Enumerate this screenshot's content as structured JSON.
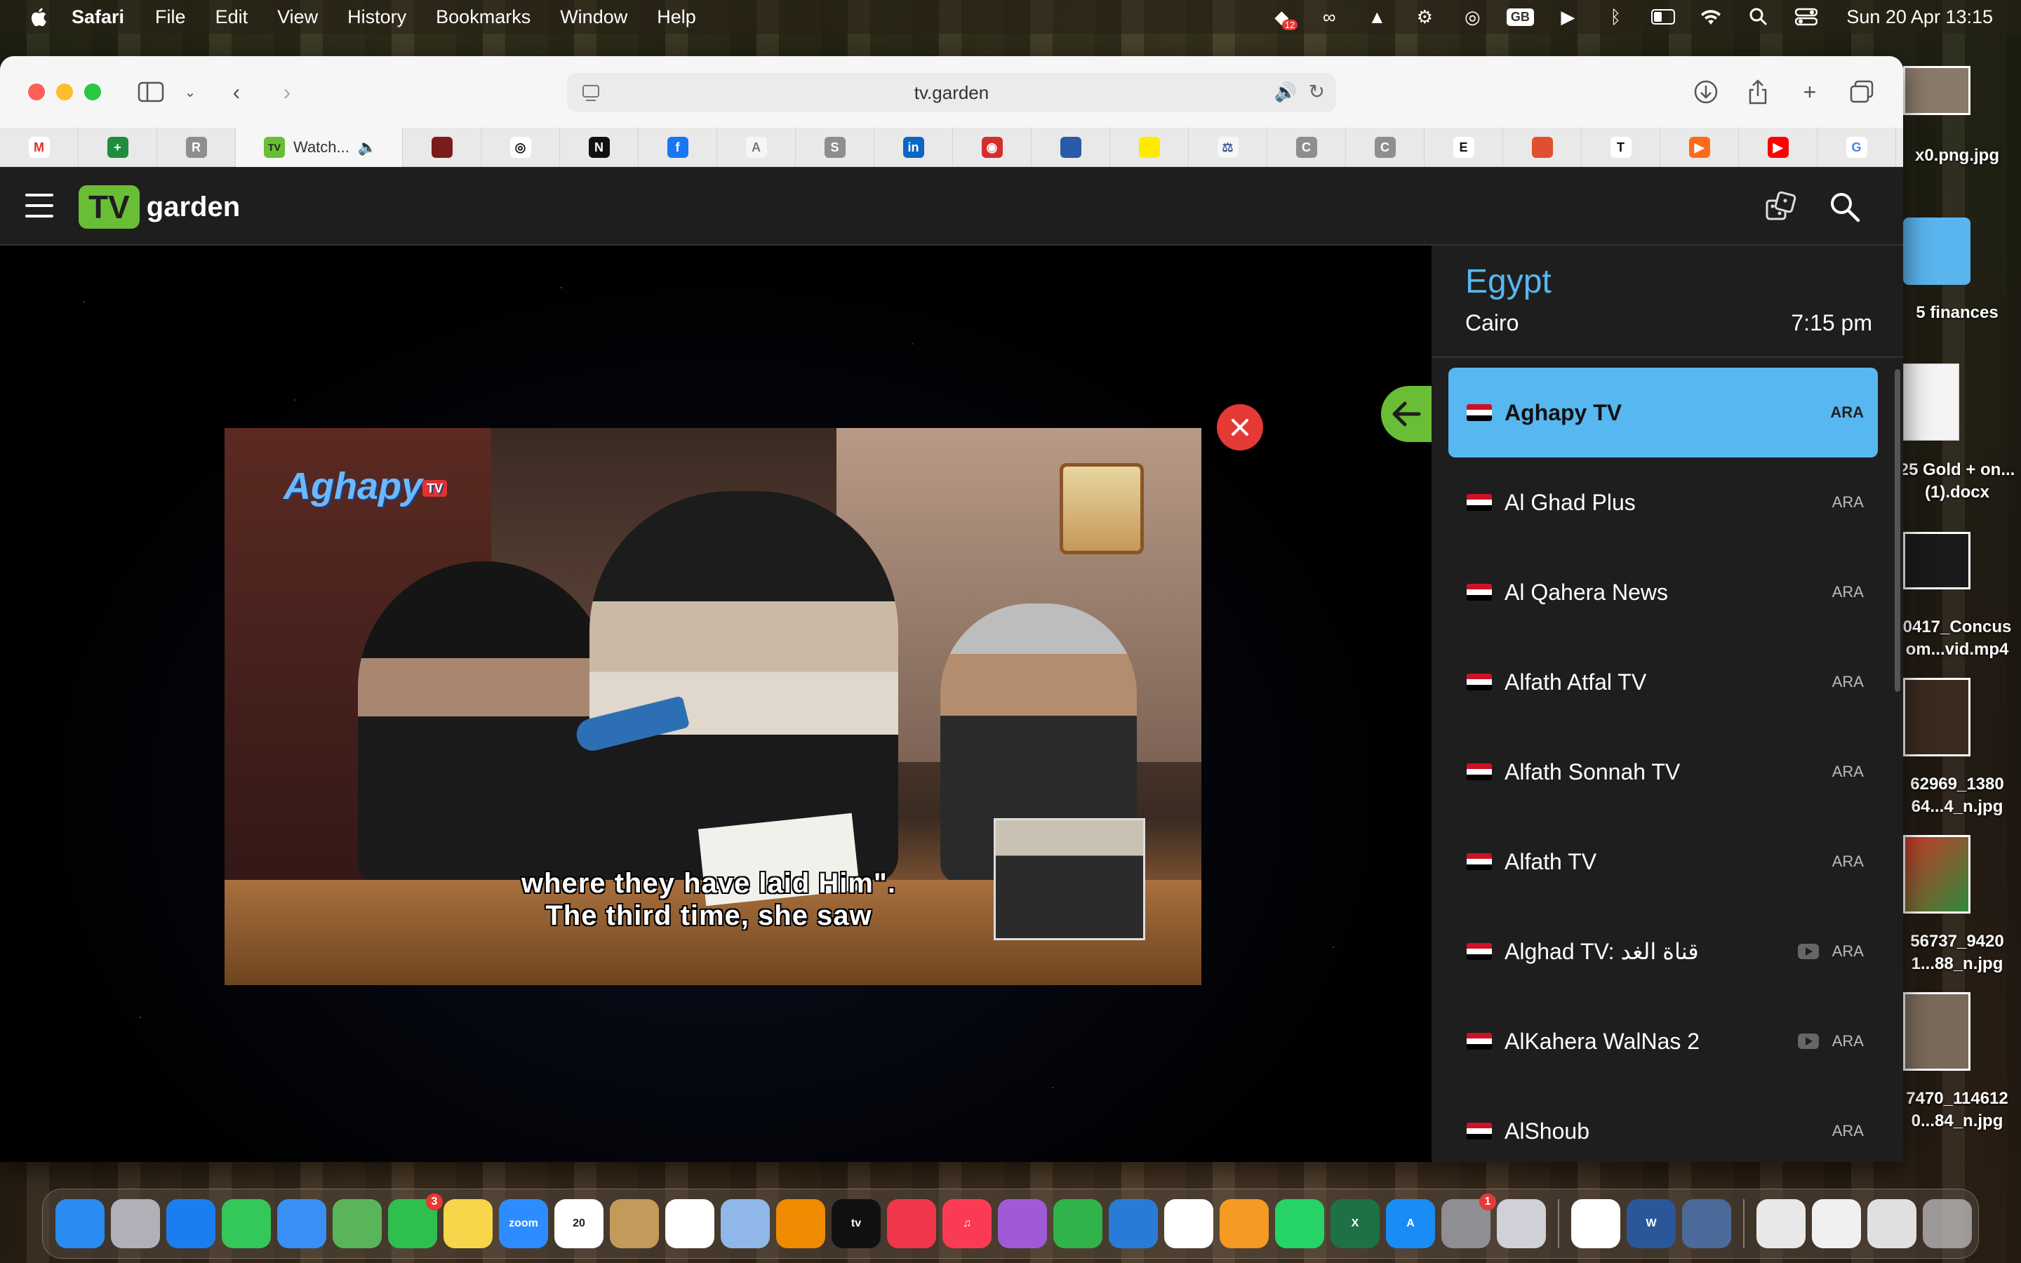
{
  "menubar": {
    "app_name": "Safari",
    "menus": [
      "File",
      "Edit",
      "View",
      "History",
      "Bookmarks",
      "Window",
      "Help"
    ],
    "status_icons": [
      "dropbox-icon",
      "creative-cloud-icon",
      "drive-icon",
      "gear-icon",
      "airdrop-icon",
      "keyboard-input-icon",
      "play-icon",
      "bluetooth-icon",
      "battery-icon",
      "wifi-icon",
      "spotlight-icon",
      "control-center-icon"
    ],
    "dropbox_badge": "12",
    "input_source": "GB",
    "datetime": "Sun 20 Apr  13:15"
  },
  "desktop": {
    "files": [
      {
        "label": "x0.png.jpg"
      },
      {
        "label": "5 finances"
      },
      {
        "label": "25 Gold + on...(1).docx"
      },
      {
        "label": "0417_Concus om...vid.mp4"
      },
      {
        "label": "62969_1380 64...4_n.jpg"
      },
      {
        "label": "56737_9420 1...88_n.jpg"
      },
      {
        "label": "7470_114612 0...84_n.jpg"
      }
    ]
  },
  "browser": {
    "address": "tv.garden",
    "active_tab": {
      "title": "Watch...",
      "favicon": "TV"
    },
    "tabs": [
      {
        "name": "gmail",
        "letter": "M",
        "color": "#ffffff",
        "fg": "#d93025"
      },
      {
        "name": "sheets",
        "letter": "+",
        "color": "#1e8e3e",
        "fg": "#ffffff"
      },
      {
        "name": "r",
        "letter": "R",
        "color": "#8e8e8e",
        "fg": "#ffffff"
      },
      {
        "name": "app",
        "letter": "",
        "color": "#7a1c1c",
        "fg": "#ffffff"
      },
      {
        "name": "instagram",
        "letter": "◎",
        "color": "#ffffff",
        "fg": "#111111"
      },
      {
        "name": "notion",
        "letter": "N",
        "color": "#111111",
        "fg": "#ffffff"
      },
      {
        "name": "facebook",
        "letter": "f",
        "color": "#1877f2",
        "fg": "#ffffff"
      },
      {
        "name": "a",
        "letter": "A",
        "color": "#f6f6f6",
        "fg": "#777777"
      },
      {
        "name": "s",
        "letter": "S",
        "color": "#8e8e8e",
        "fg": "#ffffff"
      },
      {
        "name": "linkedin",
        "letter": "in",
        "color": "#0a66c2",
        "fg": "#ffffff"
      },
      {
        "name": "eye",
        "letter": "◉",
        "color": "#d32f2f",
        "fg": "#ffffff"
      },
      {
        "name": "pattern",
        "letter": "",
        "color": "#2a5aa8",
        "fg": "#ffffff"
      },
      {
        "name": "yellow",
        "letter": "",
        "color": "#ffeb00",
        "fg": "#111111"
      },
      {
        "name": "scales",
        "letter": "⚖",
        "color": "#f6f6f6",
        "fg": "#3a5a9a"
      },
      {
        "name": "c1",
        "letter": "C",
        "color": "#8e8e8e",
        "fg": "#ffffff"
      },
      {
        "name": "c2",
        "letter": "C",
        "color": "#8e8e8e",
        "fg": "#ffffff"
      },
      {
        "name": "e",
        "letter": "E",
        "color": "#ffffff",
        "fg": "#111111"
      },
      {
        "name": "flag",
        "letter": "",
        "color": "#e05030",
        "fg": "#ffffff"
      },
      {
        "name": "nyt",
        "letter": "T",
        "color": "#ffffff",
        "fg": "#111111"
      },
      {
        "name": "play",
        "letter": "▶",
        "color": "#ff6a1a",
        "fg": "#ffffff"
      },
      {
        "name": "youtube",
        "letter": "▶",
        "color": "#ff0000",
        "fg": "#ffffff"
      },
      {
        "name": "google",
        "letter": "G",
        "color": "#ffffff",
        "fg": "#4285f4"
      }
    ]
  },
  "site": {
    "logo_tv": "TV",
    "logo_garden": "garden",
    "video": {
      "channel_logo": "Aghapy",
      "channel_logo_tag": "TV",
      "subtitle_line1": "where they have laid Him\".",
      "subtitle_line2": "The third time, she saw"
    },
    "panel": {
      "country": "Egypt",
      "city": "Cairo",
      "local_time": "7:15 pm",
      "channels": [
        {
          "name": "Aghapy TV",
          "lang": "ARA",
          "active": true,
          "youtube": false
        },
        {
          "name": "Al Ghad Plus",
          "lang": "ARA",
          "active": false,
          "youtube": false
        },
        {
          "name": "Al Qahera News",
          "lang": "ARA",
          "active": false,
          "youtube": false
        },
        {
          "name": "Alfath Atfal TV",
          "lang": "ARA",
          "active": false,
          "youtube": false
        },
        {
          "name": "Alfath Sonnah TV",
          "lang": "ARA",
          "active": false,
          "youtube": false
        },
        {
          "name": "Alfath TV",
          "lang": "ARA",
          "active": false,
          "youtube": false
        },
        {
          "name": "Alghad TV: قناة الغد",
          "lang": "ARA",
          "active": false,
          "youtube": true
        },
        {
          "name": "AlKahera WalNas 2",
          "lang": "ARA",
          "active": false,
          "youtube": true
        },
        {
          "name": "AlShoub",
          "lang": "ARA",
          "active": false,
          "youtube": false
        }
      ]
    }
  },
  "dock": {
    "apps": [
      {
        "name": "finder",
        "color": "#2a8cf0",
        "label": ""
      },
      {
        "name": "launchpad",
        "color": "#b0b0b8",
        "label": ""
      },
      {
        "name": "safari",
        "color": "#1a7ef0",
        "label": ""
      },
      {
        "name": "messages",
        "color": "#34c759",
        "label": ""
      },
      {
        "name": "mail",
        "color": "#3a8ff5",
        "label": ""
      },
      {
        "name": "maps",
        "color": "#5ab55a",
        "label": ""
      },
      {
        "name": "facetime",
        "color": "#2fbf4f",
        "label": "",
        "badge": "3"
      },
      {
        "name": "notes",
        "color": "#f7d64a",
        "label": ""
      },
      {
        "name": "zoom",
        "color": "#2d8cff",
        "label": "zoom"
      },
      {
        "name": "calendar",
        "color": "#ffffff",
        "label": "20",
        "fg": "#222222"
      },
      {
        "name": "contacts",
        "color": "#c49a5a",
        "label": ""
      },
      {
        "name": "reminders",
        "color": "#ffffff",
        "label": "",
        "fg": "#222222"
      },
      {
        "name": "preview",
        "color": "#8fb8e8",
        "label": ""
      },
      {
        "name": "vlc",
        "color": "#f08a00",
        "label": ""
      },
      {
        "name": "apple-tv",
        "color": "#111111",
        "label": "tv"
      },
      {
        "name": "news",
        "color": "#f0364a",
        "label": ""
      },
      {
        "name": "music",
        "color": "#fb3b55",
        "label": "♫"
      },
      {
        "name": "podcasts",
        "color": "#a05ad8",
        "label": ""
      },
      {
        "name": "numbers",
        "color": "#2fb34a",
        "label": ""
      },
      {
        "name": "keynote",
        "color": "#2a7bd8",
        "label": ""
      },
      {
        "name": "photos",
        "color": "#ffffff",
        "label": ""
      },
      {
        "name": "pages",
        "color": "#f59a22",
        "label": ""
      },
      {
        "name": "whatsapp",
        "color": "#25d366",
        "label": ""
      },
      {
        "name": "excel",
        "color": "#1e7145",
        "label": "X"
      },
      {
        "name": "app-store",
        "color": "#1a8cf5",
        "label": "A"
      },
      {
        "name": "system-settings",
        "color": "#8e8e93",
        "label": "",
        "badge": "1"
      },
      {
        "name": "iphone-mirroring",
        "color": "#d0d0d8",
        "label": ""
      },
      {
        "name": "chrome",
        "color": "#ffffff",
        "label": ""
      },
      {
        "name": "word",
        "color": "#2b579a",
        "label": "W"
      },
      {
        "name": "quicktime",
        "color": "#4a6a9a",
        "label": ""
      }
    ],
    "trash": "trash"
  }
}
